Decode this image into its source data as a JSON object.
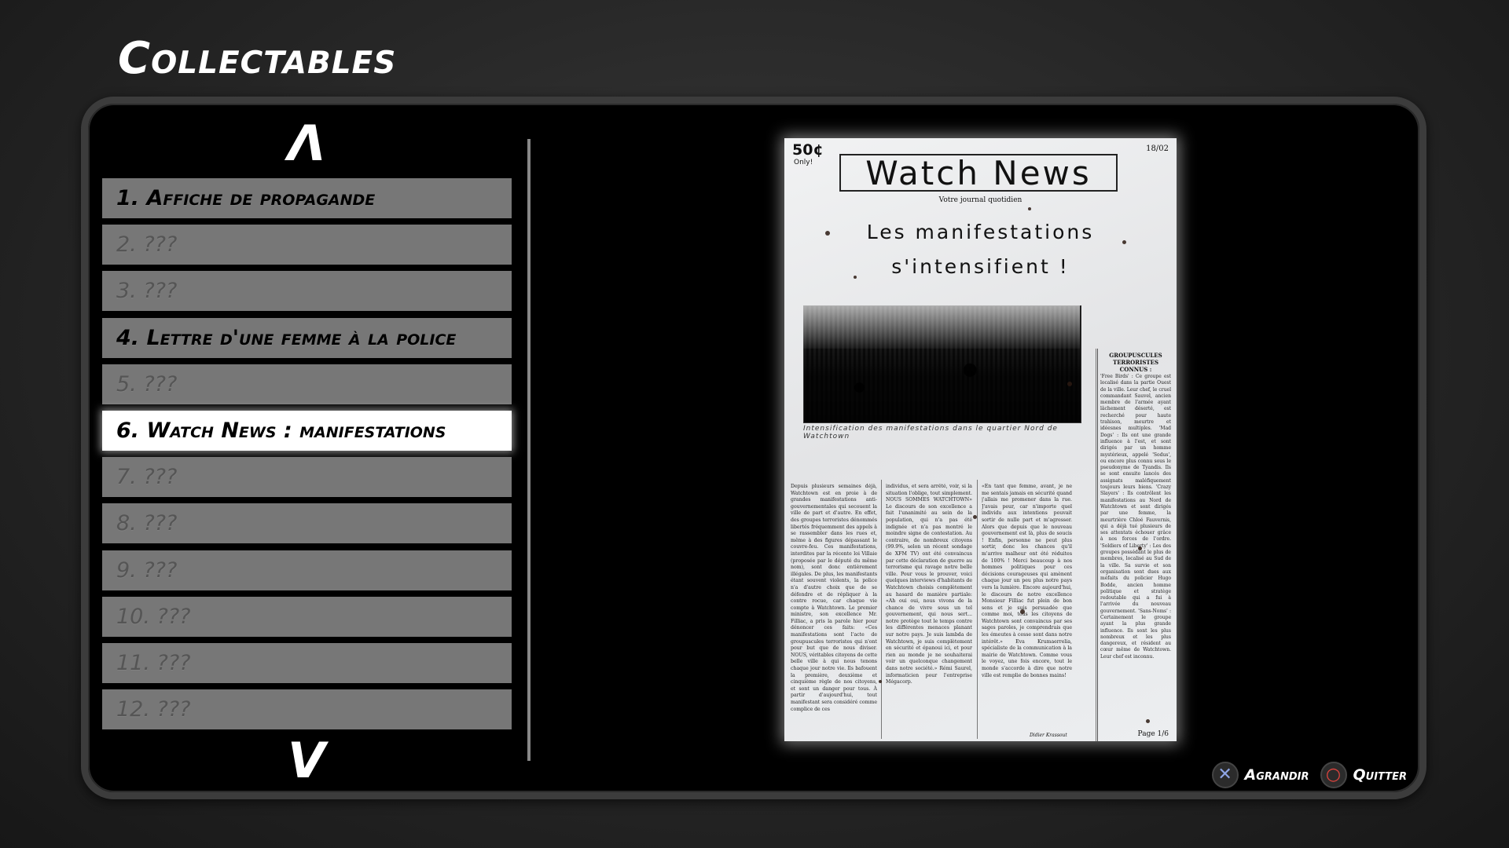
{
  "screen": {
    "title": "Collectables"
  },
  "nav": {
    "up_symbol": "Λ",
    "down_symbol": "V"
  },
  "collectables": [
    {
      "label": "1. Affiche de propagande",
      "state": "unlocked"
    },
    {
      "label": "2. ???",
      "state": "locked"
    },
    {
      "label": "3. ???",
      "state": "locked"
    },
    {
      "label": "4. Lettre d'une femme à la police",
      "state": "unlocked"
    },
    {
      "label": "5. ???",
      "state": "locked"
    },
    {
      "label": "6. Watch News : manifestations",
      "state": "selected"
    },
    {
      "label": "7. ???",
      "state": "locked"
    },
    {
      "label": "8. ???",
      "state": "locked"
    },
    {
      "label": "9. ???",
      "state": "locked"
    },
    {
      "label": "10. ???",
      "state": "locked"
    },
    {
      "label": "11. ???",
      "state": "locked"
    },
    {
      "label": "12. ???",
      "state": "locked"
    }
  ],
  "newspaper": {
    "price": "50¢",
    "price_sub": "Only!",
    "date": "18/02",
    "masthead": "Watch News",
    "tagline": "Votre journal quotidien",
    "headline_line1": "Les manifestations",
    "headline_line2": "s'intensifient !",
    "photo_caption": "Intensification des manifestations dans le quartier Nord de Watchtown",
    "sidebar_title": "GROUPUSCULES TERRORISTES CONNUS :",
    "sidebar_text": "'Free Birds' : Ce groupe est localisé dans la partie Ouest de la ville. Leur chef, le cruel commandant Sauvel, ancien membre de l'armée ayant lâchement déserté, est recherché pour haute trahison, meurtre et idéesnes multiples. 'Mad Dogs' : Ils ont une grande influence à l'est, et sont dirigés par un homme mystérieux, appelé 'Sodus', ou encore plus connu sous le pseudonyme de Tyandis. Ils se sont ensuite lancés des assignats maléfiquement toujours leurs biens. 'Crazy Slayers' : Ils contrôlent les manifestations au Nord de Watchtown et sont dirigés par une femme, la meurtrière Chloé Fauvernis, qui a déjà tué plusieurs de ses attentats échouer grâce à nos forces de l'ordre. 'Soldiers of Liberty' : Les des groupes possédant le plus de membres, localisé au Sud de la ville. Sa survie et son organisation sont dues aux méfaits du policier Hugo Bodde, ancien homme politique et stratège redoutable qui a fui à l'arrivée du nouveau gouvernement. 'Sans-Noms' : Certainement le groupe ayant la plus grande influence. Ils sont les plus nombreux et les plus dangereux, et résident au cœur même de Watchtown. Leur chef est inconnu.",
    "col1_text": "Depuis plusieurs semaines déjà, Watchtown est en proie à de grandes manifestations anti-gouvernementales qui secouent la ville de part et d'autre. En effet, des groupes terroristes dénommés libertés fréquemment des appels à se rassembler dans les rues et, même à des figures dépassant le couvre-feu. Ces manifestations, interdites par la récente loi Villaie (proposée par le député du même nom), sont donc entièrement illégales. De plus, les manifestants étant souvent violents, la police n'a d'autre choix que de se défendre et de répliquer à la contre rocue, car chaque vie compte à Watchtown. Le premier ministre, son excellence Mr. Filliac, a pris la parole hier pour dénoncer ces faits: «Ces manifestations sont l'acte de groupuscules terroristes qui n'ont pour but que de nous diviser. NOUS, véritables citoyens de cette belle ville à qui nous tenons chaque jour notre vie. Ils bafouent la première, deuxième et cinquième règle de nos citoyens, et sont un danger pour tous. À partir d'aujourd'hui, tout manifestant sera considéré comme complice de ces",
    "col2_text": "individus, et sera arrêté, voir, si la situation l'oblige, tout simplement. NOUS SOMMES WATCHTOWN» Le discours de son excellence a fait l'unanimité au sein de la population, qui n'a pas été indignée et n'a pas montré le moindre signe de contestation. Au contraire, de nombreux citoyens (99.9%, selon un récent sondage de XFM TV) ont été convaincus par cette déclaration de guerre au terrorisme qui ravage notre belle ville. Pour vous le prouver, voici quelques interviews d'habitants de Watchtown choisis complètement au hasard de manière partiale: «Ah oui oui, nous vivons de la chance de vivre sous un tel gouvernement, qui nous sert... notre protège tout le temps contre les différentes menaces planant sur notre pays. Je suis lambda de Watchtown, je suis complètement en sécurité et épanoui ici, et pour rien au monde je ne souhaiterai voir un quelconque changement dans notre société.» Rémi Saurel, informaticien pour l'entreprise Mégacorp.",
    "col3_text": "«En tant que femme, avant, je ne me sentais jamais en sécurité quand j'allais me promener dans la rue. J'avais peur, car n'importe quel individu aux intentions pouvait sortir de nulle part et m'agresser. Alors que depuis que le nouveau gouvernement est là, plus de soucis ! Enfin, personne ne peut plus sortir, donc les chances qu'il m'arrive malheur ont été réduites de 100% ! Merci beaucoup à nos hommes politiques pour ces décisions courageuses qui amènent chaque jour un peu plus notre pays vers la lumière. Encore aujourd'hui, le discours de notre excellence Monsieur Filliac fut plein de bon sens et je suis persuadée que comme moi, tous les citoyens de Watchtown sont convaincus par ses sages paroles, je comprendrais que les émeutes à cesse sont dans notre intérêt.» Eva Krumaerrelia, spécialiste de la communication à la mairie de Watchtown. Comme vous le voyez, une fois encore, tout le monde s'accorde à dire que notre ville est remplie de bonnes mains!",
    "signature": "Didier Krassout",
    "page": "Page 1/6"
  },
  "prompts": [
    {
      "icon": "cross-button-icon",
      "label": "Agrandir"
    },
    {
      "icon": "circle-button-icon",
      "label": "Quitter"
    }
  ],
  "colors": {
    "panel_bg": "#000000",
    "item_bg": "#777777",
    "item_selected_bg": "#ffffff",
    "cross_button": "#8fa6e6",
    "circle_button": "#e0443e"
  }
}
